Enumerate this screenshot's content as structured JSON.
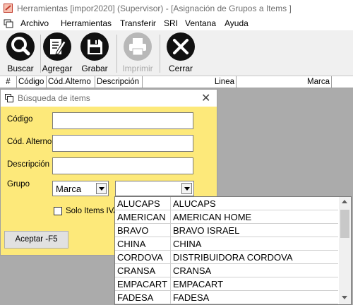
{
  "window": {
    "title": "Herramientas [impor2020] (Supervisor) - [Asignación de Grupos a Items ]"
  },
  "menu": [
    "Archivo",
    "Herramientas",
    "Transferir",
    "SRI",
    "Ventana",
    "Ayuda"
  ],
  "toolbar": {
    "buscar": "Buscar",
    "agregar": "Agregar",
    "grabar": "Grabar",
    "imprimir": "Imprimir",
    "cerrar": "Cerrar"
  },
  "grid": {
    "columns": [
      "#",
      "Código",
      "Cód.Alterno",
      "Descripción",
      "Linea",
      "Marca"
    ]
  },
  "dialog": {
    "title": "Búsqueda de items",
    "codigo_label": "Código",
    "cod_alterno_label": "Cód. Alterno",
    "descripcion_label": "Descripción",
    "grupo_label": "Grupo",
    "grupo_type_value": "Marca",
    "grupo_value": "",
    "solo_iva_label": "Solo Items IVA",
    "accept_label": "Aceptar -F5",
    "codigo_value": "",
    "cod_alterno_value": "",
    "descripcion_value": ""
  },
  "dropdown": {
    "rows": [
      {
        "code": "ALUCAPS",
        "name": "ALUCAPS"
      },
      {
        "code": "AMERICAN",
        "name": "AMERICAN HOME"
      },
      {
        "code": "BRAVO",
        "name": "BRAVO ISRAEL"
      },
      {
        "code": "CHINA",
        "name": "CHINA"
      },
      {
        "code": "CORDOVA",
        "name": "DISTRIBUIDORA CORDOVA"
      },
      {
        "code": "CRANSA",
        "name": "CRANSA"
      },
      {
        "code": "EMPACART",
        "name": "EMPACART"
      },
      {
        "code": "FADESA",
        "name": "FADESA"
      }
    ]
  }
}
